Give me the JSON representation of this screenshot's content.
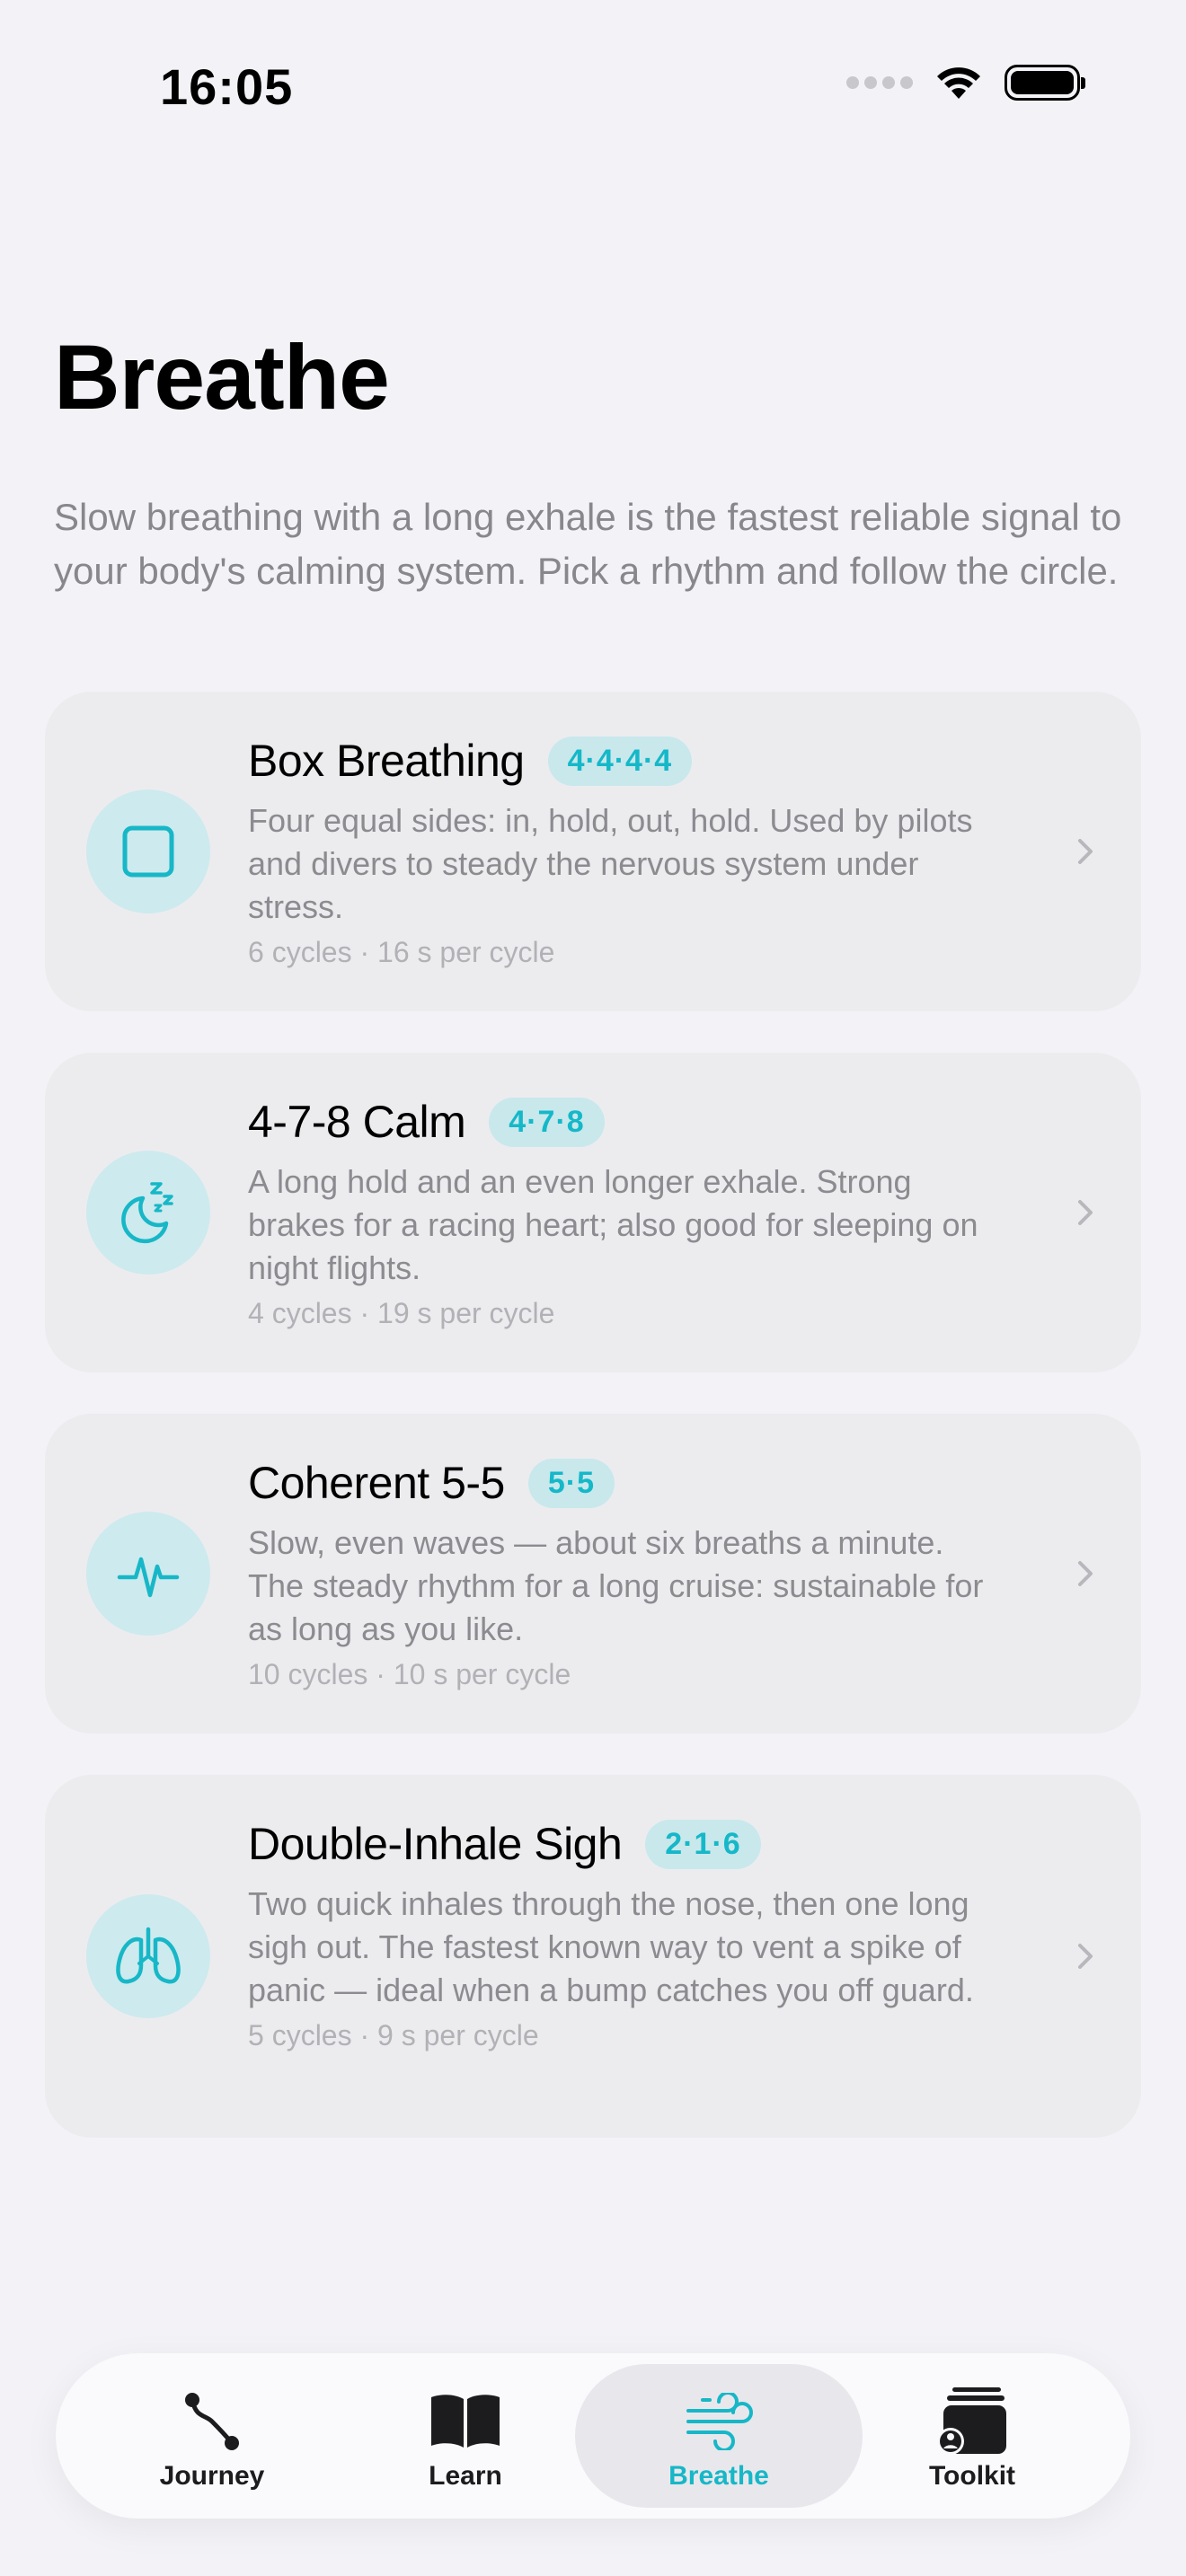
{
  "status_bar": {
    "time": "16:05"
  },
  "page": {
    "title": "Breathe",
    "intro": "Slow breathing with a long exhale is the fastest reliable signal to your body's calming system. Pick a rhythm and follow the circle."
  },
  "colors": {
    "accent": "#17b7c7",
    "badge_bg": "#c8e8ec",
    "card_bg": "#ececef",
    "page_bg": "#f3f3f7"
  },
  "exercises": [
    {
      "title": "Box Breathing",
      "badge": "4·4·4·4",
      "description": "Four equal sides: in, hold, out, hold. Used by pilots and divers to steady the nervous system under stress.",
      "meta": "6 cycles · 16 s per cycle",
      "icon": "square-icon"
    },
    {
      "title": "4-7-8 Calm",
      "badge": "4·7·8",
      "description": "A long hold and an even longer exhale. Strong brakes for a racing heart; also good for sleeping on night flights.",
      "meta": "4 cycles · 19 s per cycle",
      "icon": "moon-zzz-icon"
    },
    {
      "title": "Coherent 5-5",
      "badge": "5·5",
      "description": "Slow, even waves — about six breaths a minute. The steady rhythm for a long cruise: sustainable for as long as you like.",
      "meta": "10 cycles · 10 s per cycle",
      "icon": "waveform-pulse-icon"
    },
    {
      "title": "Double-Inhale Sigh",
      "badge": "2·1·6",
      "description": "Two quick inhales through the nose, then one long sigh out. The fastest known way to vent a spike of panic — ideal when a bump catches you off guard.",
      "meta": "5 cycles · 9 s per cycle",
      "icon": "lungs-icon"
    }
  ],
  "tabs": [
    {
      "label": "Journey",
      "icon": "path-icon",
      "selected": false
    },
    {
      "label": "Learn",
      "icon": "book-icon",
      "selected": false
    },
    {
      "label": "Breathe",
      "icon": "wind-icon",
      "selected": true
    },
    {
      "label": "Toolkit",
      "icon": "toolkit-icon",
      "selected": false
    }
  ]
}
